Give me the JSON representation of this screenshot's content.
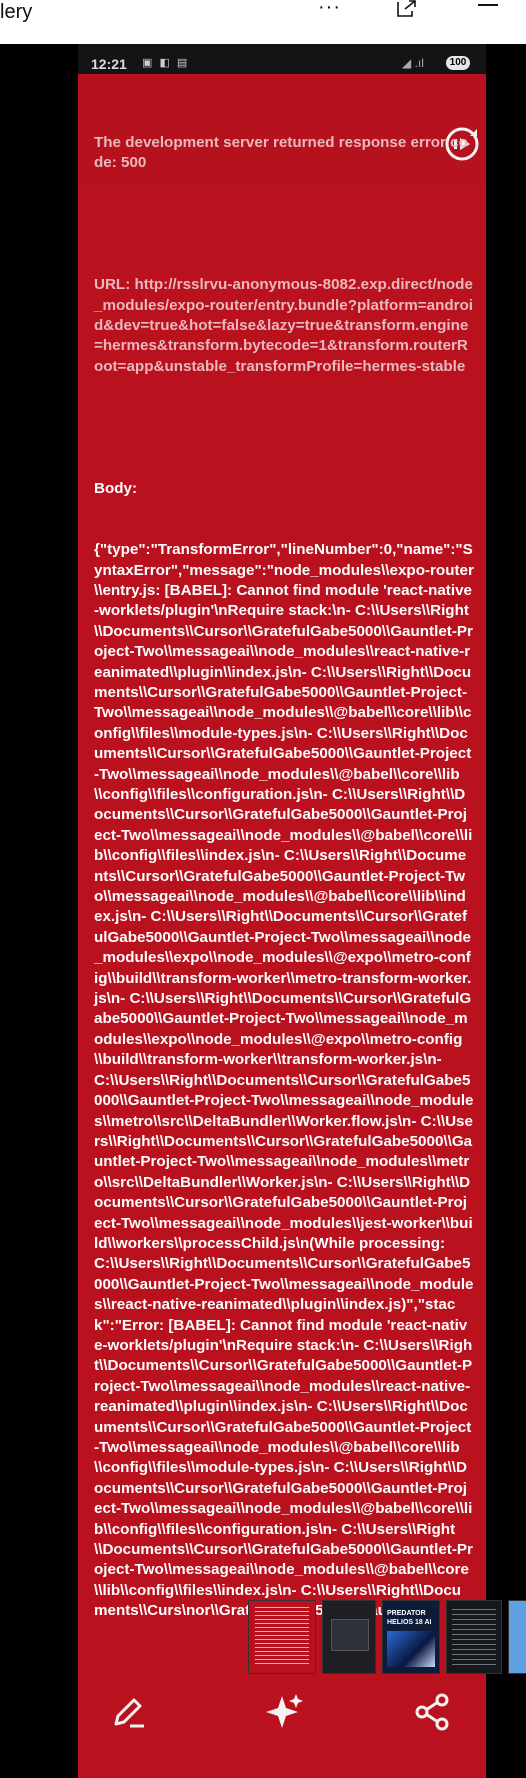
{
  "top_bar": {
    "title": "lery",
    "more_label": "···",
    "icons": [
      "more-icon",
      "open-external-icon",
      "minimize-icon"
    ]
  },
  "status_bar": {
    "time": "12:21",
    "battery": "100",
    "icons": [
      "notification-icons",
      "wifi-icon",
      "signal-icon",
      "battery-icon"
    ]
  },
  "error": {
    "heading": "The development server returned response error code: 500",
    "url_label": "URL: http://rsslrvu-anonymous-8082.exp.direct/node_modules/expo-router/entry.bundle?platform=android&dev=true&hot=false&lazy=true&transform.engine=hermes&transform.bytecode=1&transform.routerRoot=app&unstable_transformProfile=hermes-stable",
    "body_label": "Body:",
    "body_text": "{\"type\":\"TransformError\",\"lineNumber\":0,\"name\":\"SyntaxError\",\"message\":\"node_modules\\\\expo-router\\\\entry.js: [BABEL]: Cannot find module 'react-native-worklets/plugin'\\nRequire stack:\\n- C:\\\\Users\\\\Right\\\\Documents\\\\Cursor\\\\GratefulGabe5000\\\\Gauntlet-Project-Two\\\\messageai\\\\node_modules\\\\react-native-reanimated\\\\plugin\\\\index.js\\n- C:\\\\Users\\\\Right\\\\Documents\\\\Cursor\\\\GratefulGabe5000\\\\Gauntlet-Project-Two\\\\messageai\\\\node_modules\\\\@babel\\\\core\\\\lib\\\\config\\\\files\\\\module-types.js\\n- C:\\\\Users\\\\Right\\\\Documents\\\\Cursor\\\\GratefulGabe5000\\\\Gauntlet-Project-Two\\\\messageai\\\\node_modules\\\\@babel\\\\core\\\\lib\\\\config\\\\files\\\\configuration.js\\n- C:\\\\Users\\\\Right\\\\Documents\\\\Cursor\\\\GratefulGabe5000\\\\Gauntlet-Project-Two\\\\messageai\\\\node_modules\\\\@babel\\\\core\\\\lib\\\\config\\\\files\\\\index.js\\n- C:\\\\Users\\\\Right\\\\Documents\\\\Cursor\\\\GratefulGabe5000\\\\Gauntlet-Project-Two\\\\messageai\\\\node_modules\\\\@babel\\\\core\\\\lib\\\\index.js\\n- C:\\\\Users\\\\Right\\\\Documents\\\\Cursor\\\\GratefulGabe5000\\\\Gauntlet-Project-Two\\\\messageai\\\\node_modules\\\\expo\\\\node_modules\\\\@expo\\\\metro-config\\\\build\\\\transform-worker\\\\metro-transform-worker.js\\n- C:\\\\Users\\\\Right\\\\Documents\\\\Cursor\\\\GratefulGabe5000\\\\Gauntlet-Project-Two\\\\messageai\\\\node_modules\\\\expo\\\\node_modules\\\\@expo\\\\metro-config\\\\build\\\\transform-worker\\\\transform-worker.js\\n- C:\\\\Users\\\\Right\\\\Documents\\\\Cursor\\\\GratefulGabe5000\\\\Gauntlet-Project-Two\\\\messageai\\\\node_modules\\\\metro\\\\src\\\\DeltaBundler\\\\Worker.flow.js\\n- C:\\\\Users\\\\Right\\\\Documents\\\\Cursor\\\\GratefulGabe5000\\\\Gauntlet-Project-Two\\\\messageai\\\\node_modules\\\\metro\\\\src\\\\DeltaBundler\\\\Worker.js\\n- C:\\\\Users\\\\Right\\\\Documents\\\\Cursor\\\\GratefulGabe5000\\\\Gauntlet-Project-Two\\\\messageai\\\\node_modules\\\\jest-worker\\\\build\\\\workers\\\\processChild.js\\n(While processing: C:\\\\Users\\\\Right\\\\Documents\\\\Cursor\\\\GratefulGabe5000\\\\Gauntlet-Project-Two\\\\messageai\\\\node_modules\\\\react-native-reanimated\\\\plugin\\\\index.js)\",\"stack\":\"Error: [BABEL]: Cannot find module 'react-native-worklets/plugin'\\nRequire stack:\\n- C:\\\\Users\\\\Right\\\\Documents\\\\Cursor\\\\GratefulGabe5000\\\\Gauntlet-Project-Two\\\\messageai\\\\node_modules\\\\react-native-reanimated\\\\plugin\\\\index.js\\n- C:\\\\Users\\\\Right\\\\Documents\\\\Cursor\\\\GratefulGabe5000\\\\Gauntlet-Project-Two\\\\messageai\\\\node_modules\\\\@babel\\\\core\\\\lib\\\\config\\\\files\\\\module-types.js\\n- C:\\\\Users\\\\Right\\\\Documents\\\\Cursor\\\\GratefulGabe5000\\\\Gauntlet-Project-Two\\\\messageai\\\\node_modules\\\\@babel\\\\core\\\\lib\\\\config\\\\files\\\\configuration.js\\n- C:\\\\Users\\\\Right\\\\Documents\\\\Cursor\\\\GratefulGabe5000\\\\Gauntlet-Project-Two\\\\messageai\\\\node_modules\\\\@babel\\\\core\\\\lib\\\\config\\\\files\\\\index.js\\n- C:\\\\Users\\\\Right\\\\Documents\\\\Curs\\nor\\\\GratefulGabe5000\\\\Gauntlet"
  },
  "thumbnails": {
    "t3_text": "PREDATOR HELIOS 18 AI"
  },
  "bottom_bar": {
    "icons": [
      "edit-icon",
      "ai-sparkle-icon",
      "share-icon"
    ]
  },
  "colors": {
    "error_red": "#b9111e",
    "background": "#000000"
  }
}
